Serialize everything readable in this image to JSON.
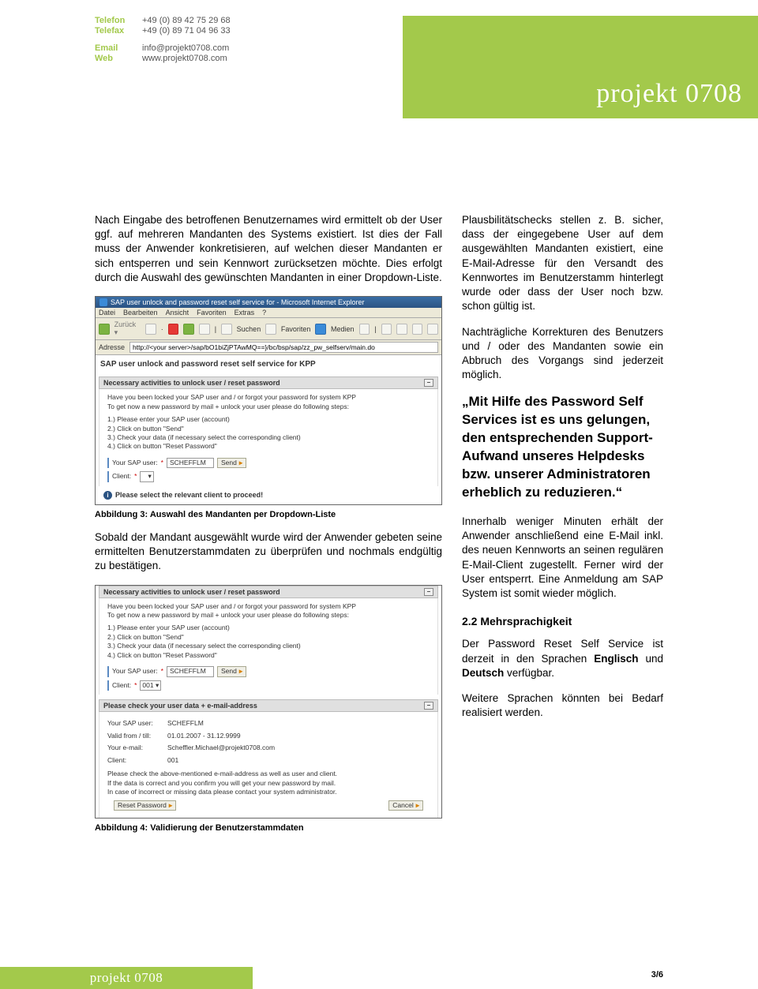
{
  "header": {
    "contact": {
      "telefon_label": "Telefon",
      "telefon": "+49 (0) 89 42 75 29 68",
      "telefax_label": "Telefax",
      "telefax": "+49 (0) 89 71 04 96 33",
      "email_label": "Email",
      "email": "info@projekt0708.com",
      "web_label": "Web",
      "web": "www.projekt0708.com"
    },
    "logo": "projekt 0708"
  },
  "left": {
    "para1": "Nach Eingabe des betroffenen Benutzernames wird ermittelt ob der User ggf. auf mehreren Mandanten des Systems existiert. Ist dies der Fall muss der Anwender konkretisieren, auf welchen dieser Mandanten er sich entsperren und sein Kennwort zurücksetzen möchte. Dies erfolgt durch die Auswahl des gewünschten Mandanten in einer Dropdown-Liste.",
    "fig3_caption": "Abbildung 3: Auswahl des Mandanten per Dropdown-Liste",
    "para2": "Sobald der Mandant ausgewählt wurde wird der Anwender gebeten seine ermittelten Benutzerstammdaten zu überprüfen und nochmals endgültig zu bestätigen.",
    "fig4_caption": "Abbildung 4: Validierung der Benutzerstammdaten"
  },
  "right": {
    "para1": "Plausbilitätschecks stellen z. B. sicher, dass der eingegebene User auf dem ausgewählten Mandanten existiert, eine E-Mail-Adresse für den Versandt des Kennwortes im Benutzerstamm hinterlegt wurde oder dass der User noch bzw. schon gültig ist.",
    "para2": "Nachträgliche Korrekturen des Benutzers und / oder des Mandanten sowie ein Abbruch des Vorgangs sind jederzeit möglich.",
    "quote": "„Mit Hilfe des Password Self Services ist es uns gelungen, den entsprechenden Support-Aufwand unseres Helpdesks bzw. unserer Administratoren erheblich zu reduzieren.“",
    "para3": "Innerhalb weniger Minuten erhält der Anwender anschließend eine E-Mail inkl. des neuen Kennworts an seinen regulären E-Mail-Client zugestellt. Ferner wird der User entsperrt. Eine Anmeldung am SAP System ist somit wieder möglich.",
    "section_head": "2.2   Mehrsprachigkeit",
    "para4_a": "Der Password Reset Self Service ist derzeit in den Sprachen ",
    "para4_eng": "Englisch",
    "para4_b": " und ",
    "para4_de": "Deutsch",
    "para4_c": " verfügbar.",
    "para5": "Weitere Sprachen könnten bei Bedarf realisiert werden."
  },
  "fig3": {
    "ie_title": "SAP user unlock and password reset self service for - Microsoft Internet Explorer",
    "menu": {
      "datei": "Datei",
      "bearbeiten": "Bearbeiten",
      "ansicht": "Ansicht",
      "favoriten": "Favoriten",
      "extras": "Extras",
      "help": "?"
    },
    "toolbar": {
      "suchen": "Suchen",
      "favoriten": "Favoriten",
      "medien": "Medien"
    },
    "addr_label": "Adresse",
    "addr_url": "http://<your server>/sap/bO1biZjPTAwMQ==}/bc/bsp/sap/zz_pw_selfserv/main.do",
    "page_title": "SAP user unlock and password reset self service for KPP",
    "section1_title": "Necessary activities to unlock user / reset password",
    "intro": "Have you been locked your SAP user and / or forgot your password for system KPP\nTo get now a new password by mail + unlock your user please do following steps:",
    "steps": {
      "s1": "1.) Please enter your SAP user (account)",
      "s2": "2.) Click on button \"Send\"",
      "s3": "3.) Check your data (if necessary select the corresponding client)",
      "s4": "4.) Click on button \"Reset Password\""
    },
    "user_label": "Your SAP user:",
    "user_value": "SCHEFFLM",
    "client_label": "Client:",
    "send_btn": "Send",
    "note": "Please select the relevant client to proceed!"
  },
  "fig4": {
    "section1_title": "Necessary activities to unlock user / reset password",
    "intro": "Have you been locked your SAP user and / or forgot your password for system KPP\nTo get now a new password by mail + unlock your user please do following steps:",
    "steps": {
      "s1": "1.) Please enter your SAP user (account)",
      "s2": "2.) Click on button \"Send\"",
      "s3": "3.) Check your data (if necessary select the corresponding client)",
      "s4": "4.) Click on button \"Reset Password\""
    },
    "user_label": "Your SAP user:",
    "user_value": "SCHEFFLM",
    "client_label": "Client:",
    "client_value": "001",
    "send_btn": "Send",
    "section2_title": "Please check your user data + e-mail-address",
    "confirm_user_label": "Your SAP user:",
    "confirm_user": "SCHEFFLM",
    "valid_label": "Valid from / till:",
    "valid_value": "01.01.2007 - 31.12.9999",
    "email_label": "Your e-mail:",
    "email_value": "Scheffler.Michael@projekt0708.com",
    "client2_label": "Client:",
    "client2_value": "001",
    "confirm_text": "Please check the above-mentioned e-mail-address as well as user and client.\nIf the data is correct and you confirm you will get your new password by mail.\nIn case of incorrect or missing data please contact your system administrator.",
    "reset_btn": "Reset Password",
    "cancel_btn": "Cancel"
  },
  "footer": {
    "page": "3/6",
    "logo": "projekt 0708"
  }
}
